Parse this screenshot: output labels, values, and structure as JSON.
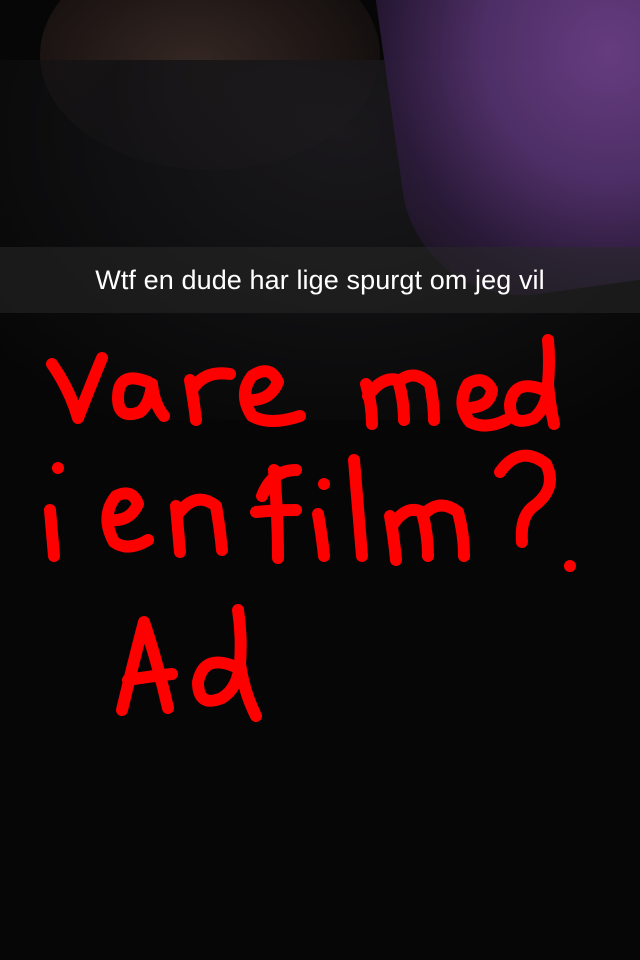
{
  "caption": {
    "text": "Wtf en dude har lige spurgt om jeg vil"
  },
  "drawing": {
    "color": "#ff0000",
    "handwritten_lines": [
      "vare med",
      "i en film?",
      "Ad"
    ]
  }
}
